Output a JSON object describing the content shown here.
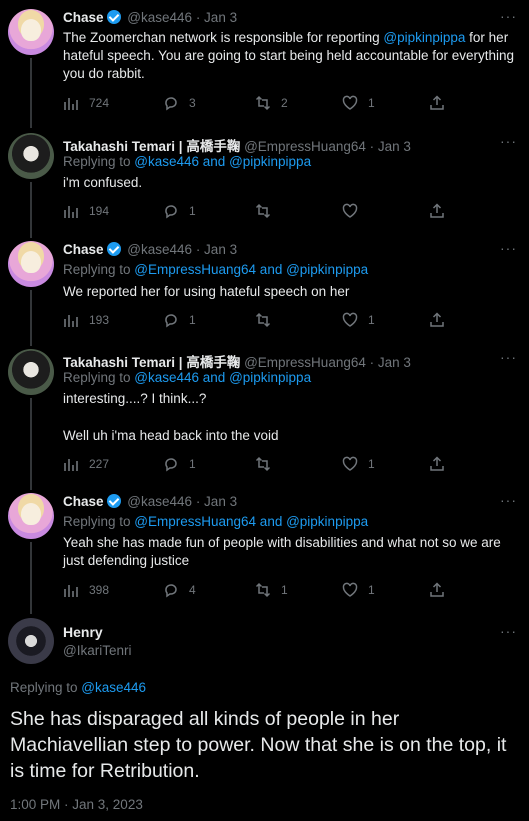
{
  "tweets": [
    {
      "name": "Chase",
      "handle": "@kase446",
      "date": "· Jan 3",
      "replying_prefix": "",
      "replying_mentions": "",
      "text_parts": [
        "The Zoomerchan network is responsible for reporting ",
        "@pipkinpippa",
        " for her hateful speech. You are going to start being held accountable for everything you do rabbit."
      ],
      "views": "724",
      "replies": "3",
      "retweets": "2",
      "likes": "1"
    },
    {
      "name": "Takahashi Temari | 高橋手鞠",
      "handle": "@EmpressHuang64",
      "date": "· Jan 3",
      "replying_prefix": "Replying to ",
      "replying_mentions": "@kase446 and @pipkinpippa",
      "text": "i'm confused.",
      "views": "194",
      "replies": "1",
      "retweets": "",
      "likes": ""
    },
    {
      "name": "Chase",
      "handle": "@kase446",
      "date": "· Jan 3",
      "replying_prefix": "Replying to ",
      "replying_mentions": "@EmpressHuang64 and @pipkinpippa",
      "text": "We reported her for using hateful speech on her",
      "views": "193",
      "replies": "1",
      "retweets": "",
      "likes": "1"
    },
    {
      "name": "Takahashi Temari | 高橋手鞠",
      "handle": "@EmpressHuang64",
      "date": "· Jan 3",
      "replying_prefix": "Replying to ",
      "replying_mentions": "@kase446 and @pipkinpippa",
      "text_line1": "interesting....? I think...?",
      "text_line2": "Well uh i'ma head back into the void",
      "views": "227",
      "replies": "1",
      "retweets": "",
      "likes": "1"
    },
    {
      "name": "Chase",
      "handle": "@kase446",
      "date": "· Jan 3",
      "replying_prefix": "Replying to ",
      "replying_mentions": "@EmpressHuang64 and @pipkinpippa",
      "text": "Yeah she has made fun of people with disabilities and what not so we are just defending justice",
      "views": "398",
      "replies": "4",
      "retweets": "1",
      "likes": "1"
    }
  ],
  "main_tweet": {
    "name": "Henry",
    "handle": "@IkariTenri",
    "replying_prefix": "Replying to ",
    "replying_mention": "@kase446",
    "text": "She has disparaged all kinds of people in her Machiavellian step to power. Now that she is on the top, it is time for Retribution.",
    "timestamp": "1:00 PM · Jan 3, 2023"
  },
  "more_glyph": "···",
  "colors": {
    "background": "#000000",
    "text": "#e7e9ea",
    "muted": "#71767b",
    "link": "#1d9bf0",
    "thread_line": "#333639"
  }
}
